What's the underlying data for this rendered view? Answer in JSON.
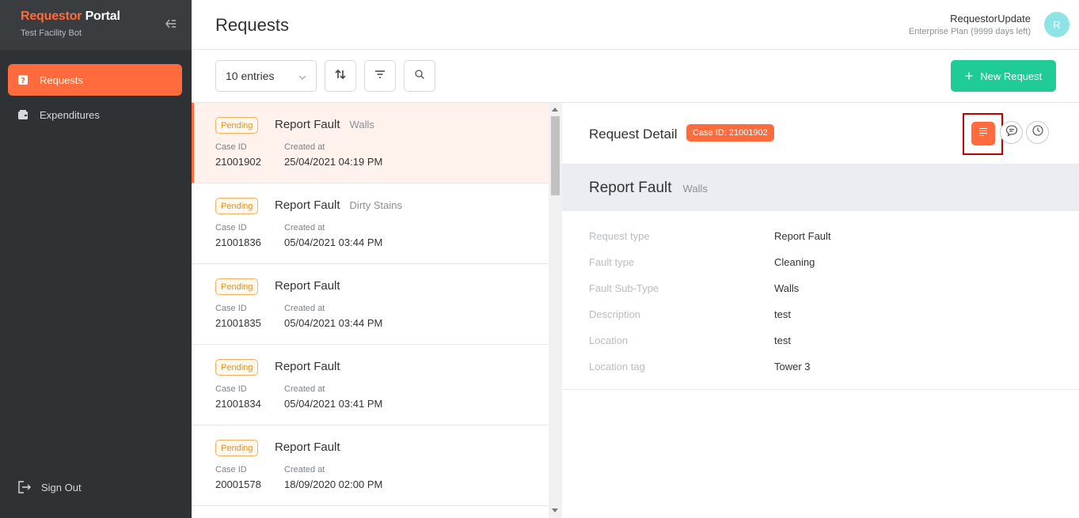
{
  "sidebar": {
    "brand_part1": "Requestor",
    "brand_part2": " Portal",
    "subtitle": "Test Facility Bot",
    "items": [
      {
        "label": "Requests",
        "icon": "question-icon",
        "active": true
      },
      {
        "label": "Expenditures",
        "icon": "wallet-icon",
        "active": false
      }
    ],
    "signout_label": "Sign Out"
  },
  "header": {
    "title": "Requests",
    "user_name": "RequestorUpdate",
    "user_plan": "Enterprise Plan (9999 days left)",
    "avatar_initial": "R"
  },
  "toolbar": {
    "entries_value": "10 entries",
    "new_request_label": "New Request"
  },
  "list": {
    "case_id_label": "Case ID",
    "created_label": "Created at",
    "items": [
      {
        "status": "Pending",
        "title": "Report Fault",
        "subtitle": "Walls",
        "case_id": "21001902",
        "created": "25/04/2021 04:19 PM"
      },
      {
        "status": "Pending",
        "title": "Report Fault",
        "subtitle": "Dirty Stains",
        "case_id": "21001836",
        "created": "05/04/2021 03:44 PM"
      },
      {
        "status": "Pending",
        "title": "Report Fault",
        "subtitle": "",
        "case_id": "21001835",
        "created": "05/04/2021 03:44 PM"
      },
      {
        "status": "Pending",
        "title": "Report Fault",
        "subtitle": "",
        "case_id": "21001834",
        "created": "05/04/2021 03:41 PM"
      },
      {
        "status": "Pending",
        "title": "Report Fault",
        "subtitle": "",
        "case_id": "20001578",
        "created": "18/09/2020 02:00 PM"
      }
    ]
  },
  "detail": {
    "title": "Request Detail",
    "case_chip": "Case ID: 21001902",
    "section_title": "Report Fault",
    "section_sub": "Walls",
    "fields": [
      {
        "key": "Request type",
        "value": "Report Fault"
      },
      {
        "key": "Fault type",
        "value": "Cleaning"
      },
      {
        "key": "Fault Sub-Type",
        "value": "Walls"
      },
      {
        "key": "Description",
        "value": "test"
      },
      {
        "key": "Location",
        "value": "test"
      },
      {
        "key": "Location tag",
        "value": "Tower 3"
      }
    ]
  },
  "colors": {
    "accent": "#ff6b3d",
    "success": "#1fcc96",
    "pending": "#e8911f"
  }
}
